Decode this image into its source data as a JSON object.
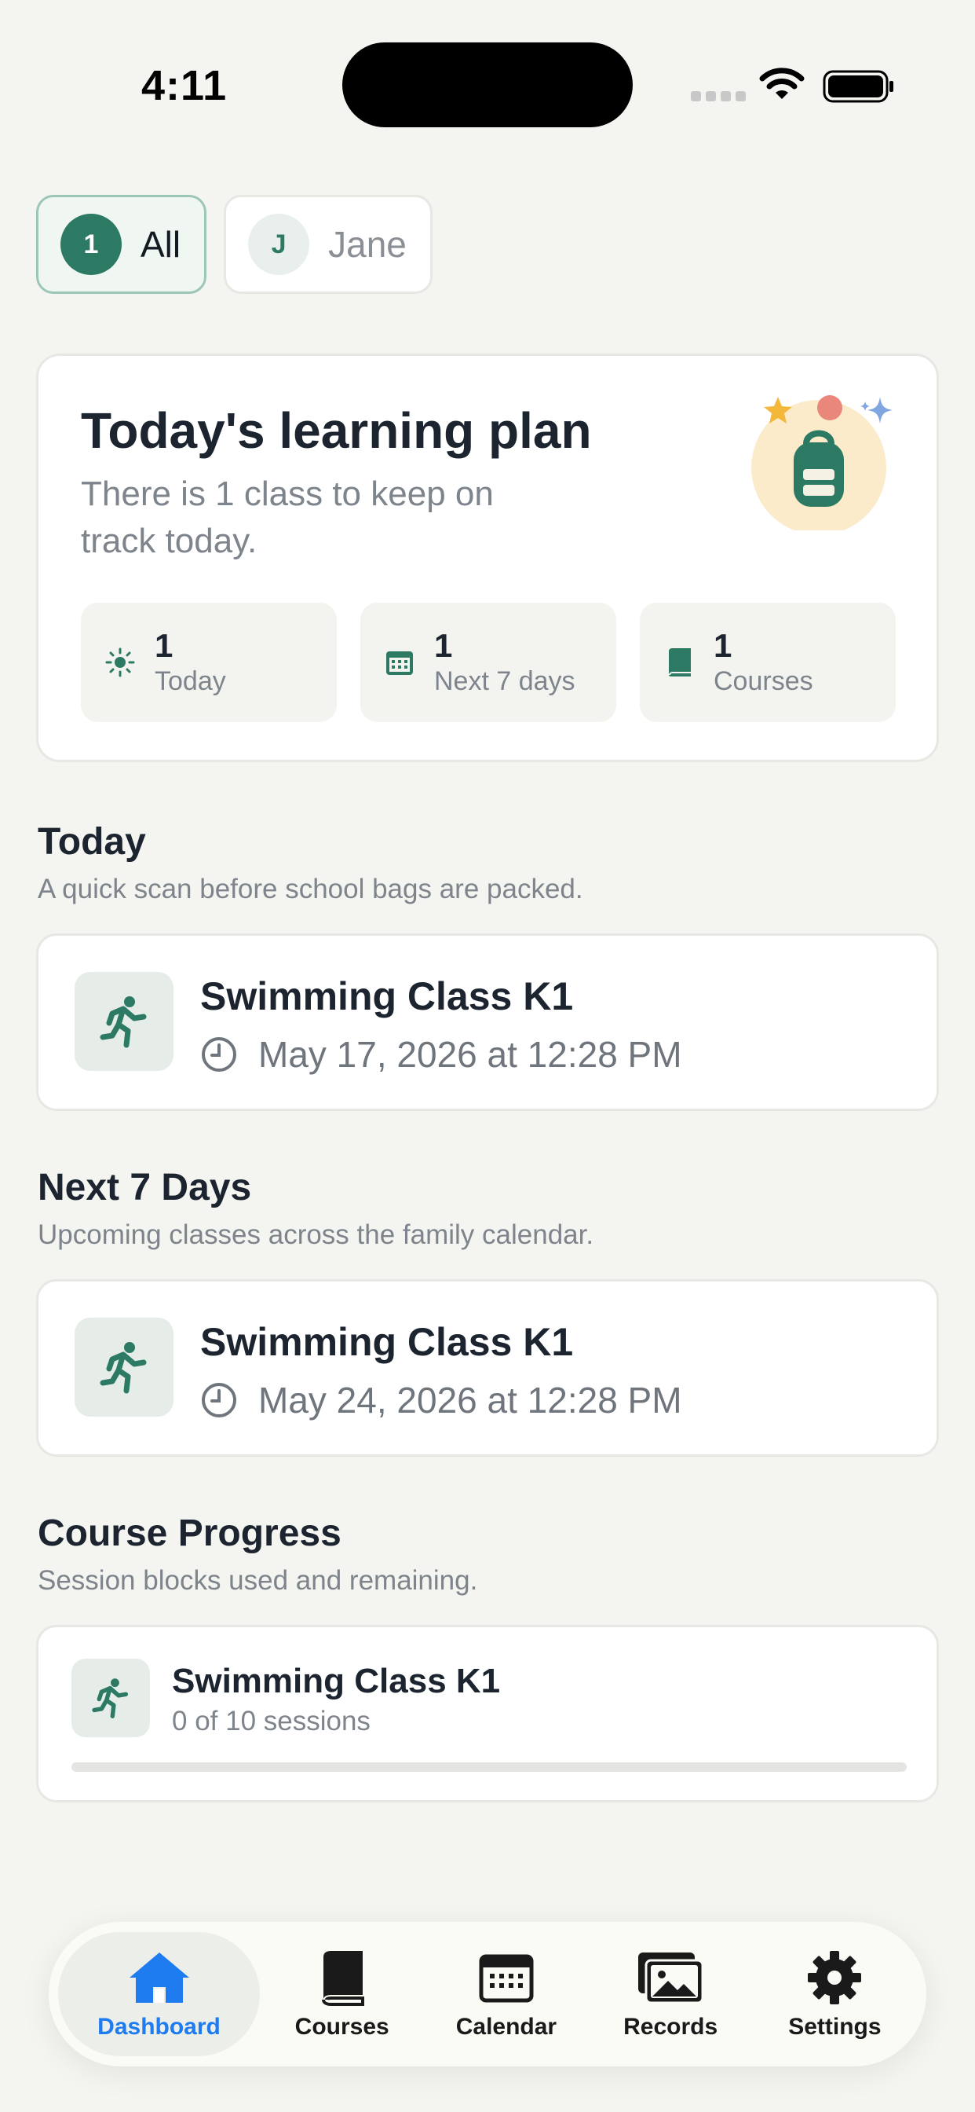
{
  "status_bar": {
    "time": "4:11"
  },
  "filters": [
    {
      "badge": "1",
      "label": "All",
      "active": true
    },
    {
      "badge": "J",
      "label": "Jane",
      "active": false
    }
  ],
  "plan": {
    "title": "Today's learning plan",
    "subtitle": "There is 1 class to keep on track today.",
    "stats": [
      {
        "icon": "sun-icon",
        "value": "1",
        "label": "Today"
      },
      {
        "icon": "calendar-icon",
        "value": "1",
        "label": "Next 7 days"
      },
      {
        "icon": "book-icon",
        "value": "1",
        "label": "Courses"
      }
    ]
  },
  "today": {
    "title": "Today",
    "subtitle": "A quick scan before school bags are packed.",
    "item": {
      "name": "Swimming Class K1",
      "time": "May 17, 2026 at 12:28 PM",
      "icon": "running-person-icon"
    }
  },
  "next7": {
    "title": "Next 7 Days",
    "subtitle": "Upcoming classes across the family calendar.",
    "item": {
      "name": "Swimming Class K1",
      "time": "May 24, 2026 at 12:28 PM",
      "icon": "running-person-icon"
    }
  },
  "progress": {
    "title": "Course Progress",
    "subtitle": "Session blocks used and remaining.",
    "item": {
      "name": "Swimming Class K1",
      "count": "0 of 10 sessions",
      "fraction": 0
    }
  },
  "tabs": [
    {
      "label": "Dashboard",
      "icon": "house-icon",
      "active": true
    },
    {
      "label": "Courses",
      "icon": "book-icon",
      "active": false
    },
    {
      "label": "Calendar",
      "icon": "calendar-icon",
      "active": false
    },
    {
      "label": "Records",
      "icon": "photos-icon",
      "active": false
    },
    {
      "label": "Settings",
      "icon": "gear-icon",
      "active": false
    }
  ],
  "colors": {
    "accent": "#2c7a64",
    "tab_active": "#1e7bf0",
    "background": "#f4f5f1"
  }
}
